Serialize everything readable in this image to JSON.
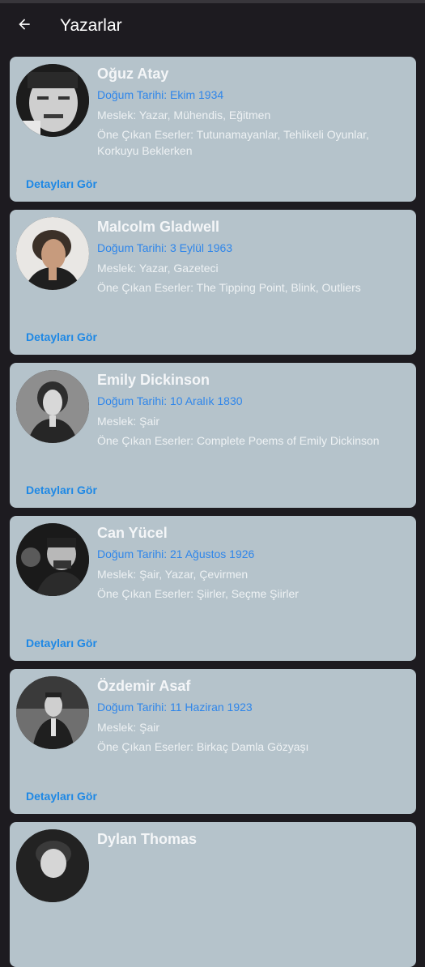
{
  "header": {
    "title": "Yazarlar"
  },
  "authors": [
    {
      "name": "Oğuz Atay",
      "birth": "Doğum Tarihi: Ekim 1934",
      "job": "Meslek: Yazar, Mühendis, Eğitmen",
      "works": "Öne Çıkan Eserler: Tutunamayanlar, Tehlikeli Oyunlar, Korkuyu Beklerken",
      "details_label": "Detayları Gör"
    },
    {
      "name": "Malcolm Gladwell",
      "birth": "Doğum Tarihi: 3 Eylül 1963",
      "job": "Meslek: Yazar, Gazeteci",
      "works": "Öne Çıkan Eserler: The Tipping Point, Blink, Outliers",
      "details_label": "Detayları Gör"
    },
    {
      "name": "Emily Dickinson",
      "birth": "Doğum Tarihi: 10 Aralık 1830",
      "job": "Meslek: Şair",
      "works": "Öne Çıkan Eserler: Complete Poems of Emily Dickinson",
      "details_label": "Detayları Gör"
    },
    {
      "name": "Can Yücel",
      "birth": "Doğum Tarihi: 21 Ağustos 1926",
      "job": "Meslek: Şair, Yazar, Çevirmen",
      "works": "Öne Çıkan Eserler: Şiirler, Seçme Şiirler",
      "details_label": "Detayları Gör"
    },
    {
      "name": "Özdemir Asaf",
      "birth": "Doğum Tarihi: 11 Haziran 1923",
      "job": "Meslek: Şair",
      "works": "Öne Çıkan Eserler: Birkaç Damla Gözyaşı",
      "details_label": "Detayları Gör"
    },
    {
      "name": "Dylan Thomas",
      "birth": "",
      "job": "",
      "works": "",
      "details_label": ""
    }
  ],
  "icons": {
    "back": "arrow-left-icon",
    "avatar": "portrait-photo"
  },
  "colors": {
    "background": "#1d1b20",
    "card": "#b5c3cb",
    "accent": "#1e88e5"
  }
}
